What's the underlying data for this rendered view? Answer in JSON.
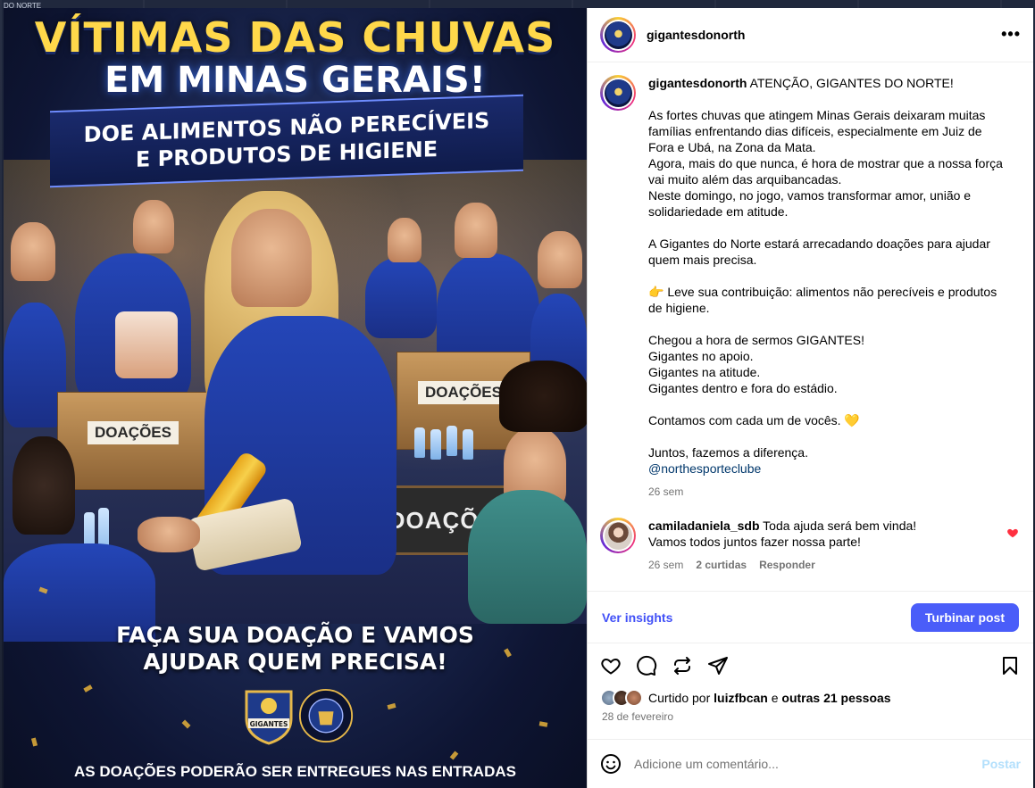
{
  "backdrop": {
    "corner_tag": "DO NORTE"
  },
  "poster": {
    "headline_line1": "VÍTIMAS DAS CHUVAS",
    "headline_line2": "EM MINAS GERAIS!",
    "banner_line1": "DOE ALIMENTOS NÃO PERECÍVEIS",
    "banner_line2": "E PRODUTOS DE HIGIENE",
    "box_label_1": "DOAÇÕES",
    "box_label_2": "DOAÇÕES",
    "chalkboard_label": "DOAÇÕES",
    "cta_line1": "FAÇA SUA DOAÇÃO E VAMOS",
    "cta_line2": "AJUDAR QUEM PRECISA!",
    "crest_left_text": "GIGANTES",
    "crest_right_text": "NORTH ESPORTE CLUBE",
    "footer": "AS DOAÇÕES PODERÃO SER ENTREGUES NAS ENTRADAS"
  },
  "header": {
    "username": "gigantesdonorth",
    "more_icon": "more-horizontal-icon"
  },
  "caption": {
    "username": "gigantesdonorth",
    "lines": {
      "l1": "ATENÇÃO, GIGANTES DO NORTE!",
      "l2": "As fortes chuvas que atingem Minas Gerais deixaram muitas famílias enfrentando dias difíceis, especialmente em Juiz de Fora e Ubá, na Zona da Mata.",
      "l3": "Agora, mais do que nunca, é hora de mostrar que a nossa força vai muito além das arquibancadas.",
      "l4": "Neste domingo, no jogo, vamos transformar amor, união e solidariedade em atitude.",
      "l5": "A Gigantes do Norte estará arrecadando doações para ajudar quem mais precisa.",
      "l6": "👉 Leve sua contribuição: alimentos não perecíveis e produtos de higiene.",
      "l7": "Chegou a hora de sermos GIGANTES!",
      "l8": "Gigantes no apoio.",
      "l9": "Gigantes na atitude.",
      "l10": "Gigantes dentro e fora do estádio.",
      "l11": "Contamos com cada um de vocês. 💛",
      "l12": "Juntos, fazemos a diferença.",
      "mention": "@northesporteclube"
    },
    "time": "26 sem"
  },
  "comment": {
    "username": "camiladaniela_sdb",
    "text_line1": "Toda ajuda será bem vinda!",
    "text_line2": "Vamos todos juntos fazer nossa parte!",
    "time": "26 sem",
    "shares": "2 curtidas",
    "reply": "Responder",
    "liked": true
  },
  "insights": {
    "link_label": "Ver insights",
    "boost_label": "Turbinar post"
  },
  "actions": {
    "icons": [
      "heart-icon",
      "comment-icon",
      "repost-icon",
      "share-icon",
      "bookmark-icon"
    ]
  },
  "likes": {
    "prefix": "Curtido por",
    "user": "luizfbcan",
    "connector": "e",
    "others": "outras 21 pessoas"
  },
  "date": "28 de fevereiro",
  "add_comment": {
    "placeholder": "Adicione um comentário...",
    "post_label": "Postar"
  },
  "colors": {
    "accent": "#4a5df9",
    "link": "#4150f7",
    "muted": "#737373",
    "heart": "#ff3040",
    "poster_gold": "#ffd84a"
  }
}
